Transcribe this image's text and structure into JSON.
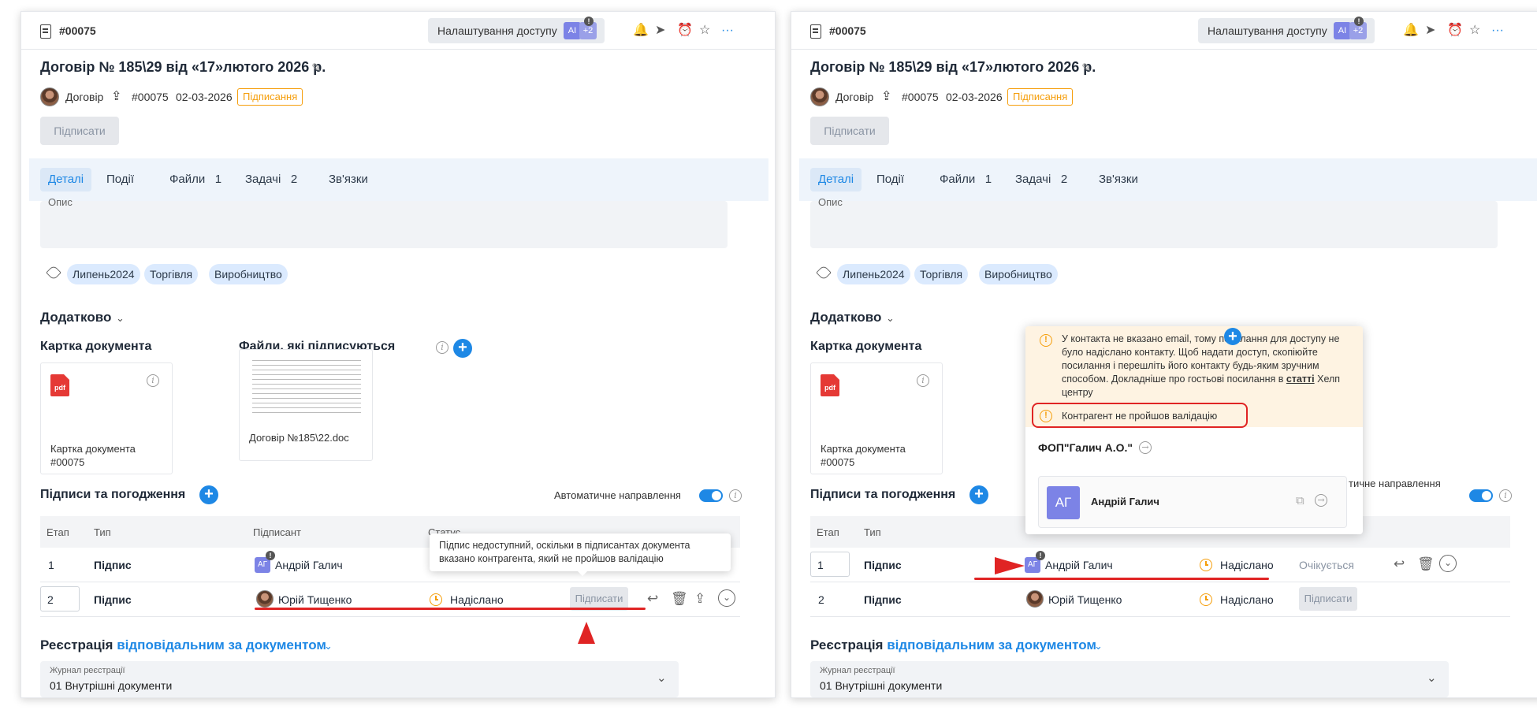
{
  "doc": {
    "number": "#00075",
    "access_button": "Налаштування доступу",
    "access_avatar": "AI",
    "access_more": "+2",
    "title": "Договір № 185\\29 від «17»лютого 2026 р.",
    "type": "Договір",
    "num_plain": "#00075",
    "date": "02-03-2026",
    "status": "Підписання",
    "sign_button": "Підписати"
  },
  "tabs": [
    {
      "label": "Деталі"
    },
    {
      "label": "Події"
    },
    {
      "label": "Файли",
      "count": "1"
    },
    {
      "label": "Задачі",
      "count": "2"
    },
    {
      "label": "Зв'язки"
    }
  ],
  "description_label": "Опис",
  "tags": [
    "Липень2024",
    "Торгівля",
    "Виробництво"
  ],
  "extra_section": "Додатково",
  "card": {
    "heading": "Картка документа",
    "file_type": "pdf",
    "label": "Картка документа\n#00075"
  },
  "signed_files": {
    "heading": "Файли, які підписуються",
    "file_label": "Договір №185\\22.doc"
  },
  "signatures": {
    "heading": "Підписи та погодження",
    "auto_label": "Автоматичне направлення",
    "auto_on": true,
    "columns": [
      "Етап",
      "Тип",
      "Підписант",
      "Статус"
    ],
    "rows": [
      {
        "stage": "1",
        "type": "Підпис",
        "initials": "АГ",
        "signer": "Андрій Галич",
        "status": "Надіслано",
        "state": "Очікується",
        "button": "Підписати"
      },
      {
        "stage": "2",
        "type": "Підпис",
        "initials": "",
        "signer": "Юрій Тищенко",
        "status": "Надіслано",
        "state": "",
        "button": "Підписати"
      }
    ]
  },
  "tooltip": "Підпис недоступний, оскільки в підписантах документа вказано контрагента, який не пройшов валідацію",
  "registration": {
    "prefix": "Реєстрація",
    "link": "відповідальним за документом",
    "journal_label": "Журнал реєстрації",
    "journal_value": "01 Внутрішні документи"
  },
  "popup": {
    "warning_main": "У контакта не вказано email, тому посилання для доступу не було надіслано контакту. Щоб надати доступ, скопіюйте посилання і перешліть його контакту будь-яким зручним способом. Докладніше про гостьові посилання в ",
    "warning_link": "статті",
    "warning_tail": " Хелп центру",
    "warning_validation": "Контрагент не пройшов валідацію",
    "company": "ФОП\"Галич А.О.\"",
    "contact_initials": "АГ",
    "contact_name": "Андрій Галич"
  },
  "colors": {
    "accent": "#1e88e5",
    "warning": "#f59e0b",
    "annotation_red": "#e02424",
    "avatar": "#7c83e6"
  },
  "icons": [
    "doc-icon",
    "bell-icon",
    "send-icon",
    "alarm-icon",
    "star-icon",
    "more-icon",
    "pencil-icon",
    "upload-icon",
    "tag-icon",
    "info-icon",
    "plus-icon",
    "chevron-down-icon",
    "reply-icon",
    "trash-icon",
    "clock-icon",
    "copy-icon",
    "arrow-right-circle-icon"
  ]
}
